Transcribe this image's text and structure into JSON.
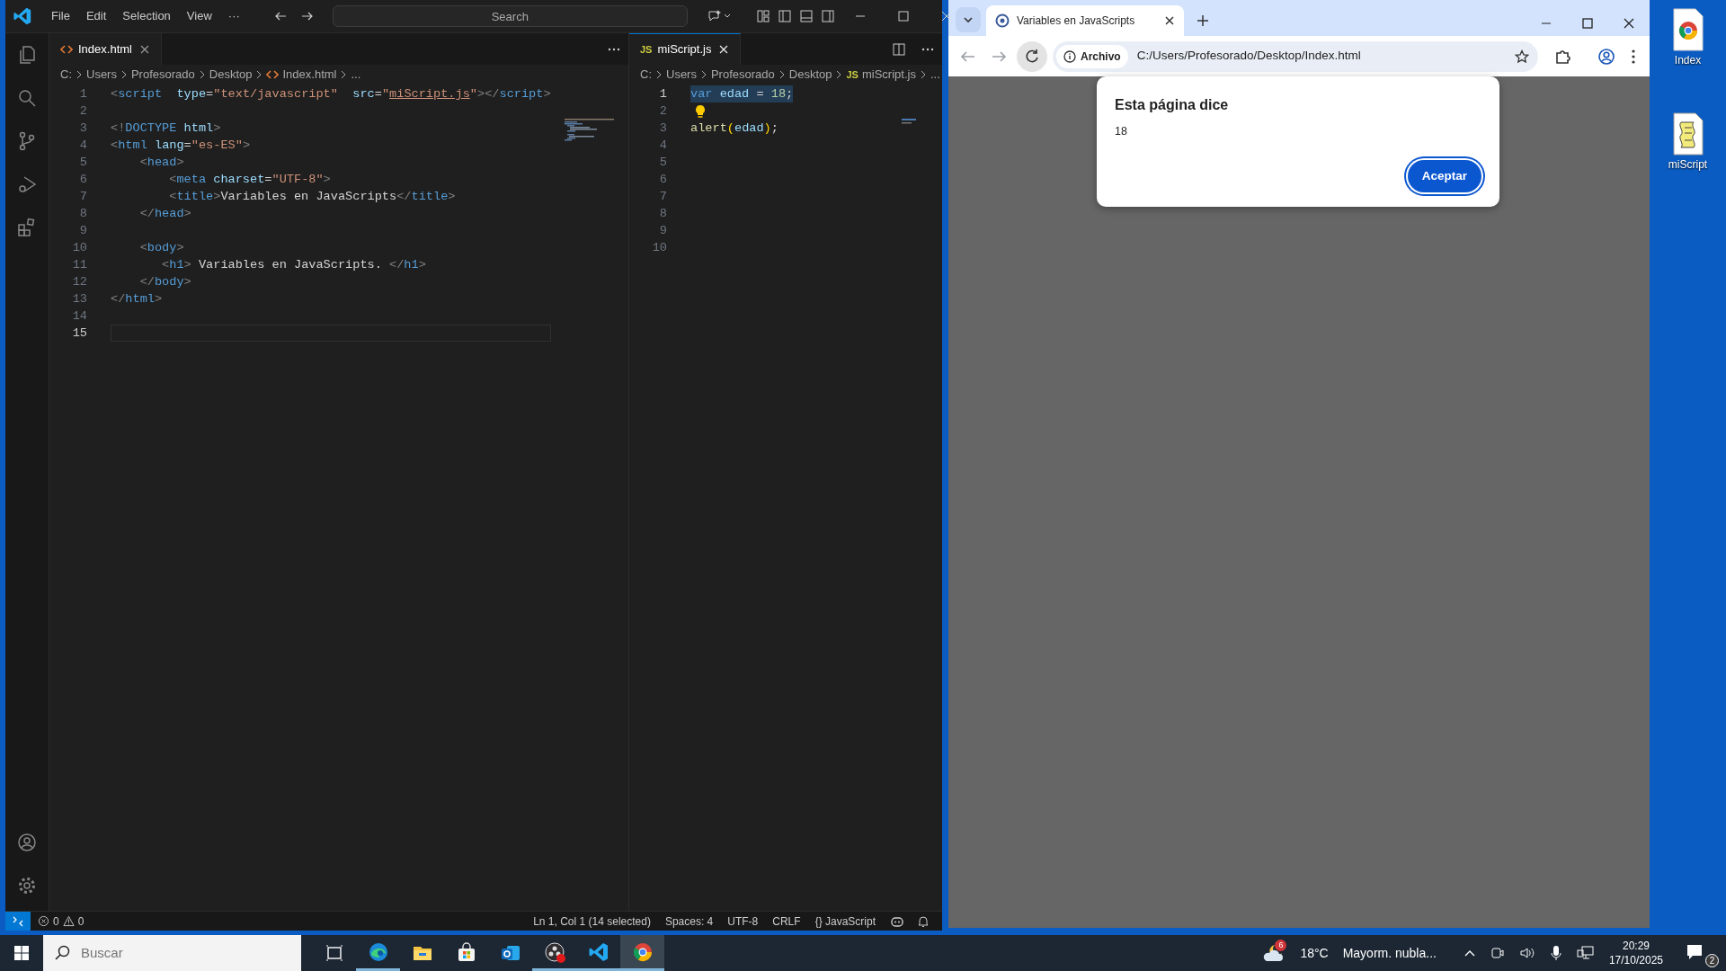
{
  "vscode": {
    "menu": [
      "File",
      "Edit",
      "Selection",
      "View",
      "···"
    ],
    "search": {
      "placeholder": "Search"
    },
    "groups": [
      {
        "focused": false,
        "tab": {
          "label": "Index.html",
          "kind": "html",
          "selected": true
        },
        "breadcrumb": [
          {
            "text": "C:"
          },
          {
            "text": "Users"
          },
          {
            "text": "Profesorado"
          },
          {
            "text": "Desktop"
          },
          {
            "text": "Index.html",
            "kind": "html"
          },
          {
            "text": "..."
          }
        ],
        "lines": [
          {
            "number": "1",
            "current": false,
            "tokens": [
              {
                "kind": "punct",
                "text": "<"
              },
              {
                "kind": "tag",
                "text": "script"
              },
              {
                "kind": "attr",
                "text": "  type"
              },
              {
                "kind": "text",
                "text": "="
              },
              {
                "kind": "string",
                "text": "\"text/javascript\""
              },
              {
                "kind": "attr",
                "text": "  src"
              },
              {
                "kind": "text",
                "text": "="
              },
              {
                "kind": "string",
                "text": "\""
              },
              {
                "kind": "link",
                "text": "miScript.js"
              },
              {
                "kind": "string",
                "text": "\""
              },
              {
                "kind": "punct",
                "text": "></"
              },
              {
                "kind": "tag",
                "text": "script"
              },
              {
                "kind": "punct",
                "text": ">"
              }
            ]
          },
          {
            "number": "2",
            "current": false
          },
          {
            "number": "3",
            "current": false,
            "tokens": [
              {
                "kind": "punct",
                "text": "<!"
              },
              {
                "kind": "tag",
                "text": "DOCTYPE"
              },
              {
                "kind": "attr",
                "text": " html"
              },
              {
                "kind": "punct",
                "text": ">"
              }
            ]
          },
          {
            "number": "4",
            "current": false,
            "tokens": [
              {
                "kind": "punct",
                "text": "<"
              },
              {
                "kind": "tag",
                "text": "html"
              },
              {
                "kind": "attr",
                "text": " lang"
              },
              {
                "kind": "text",
                "text": "="
              },
              {
                "kind": "string",
                "text": "\"es-ES\""
              },
              {
                "kind": "punct",
                "text": ">"
              }
            ]
          },
          {
            "number": "5",
            "current": false,
            "tokens": [
              {
                "kind": "punct",
                "text": "    <"
              },
              {
                "kind": "tag",
                "text": "head"
              },
              {
                "kind": "punct",
                "text": ">"
              }
            ]
          },
          {
            "number": "6",
            "current": false,
            "tokens": [
              {
                "kind": "punct",
                "text": "        <"
              },
              {
                "kind": "tag",
                "text": "meta"
              },
              {
                "kind": "attr",
                "text": " charset"
              },
              {
                "kind": "text",
                "text": "="
              },
              {
                "kind": "string",
                "text": "\"UTF-8\""
              },
              {
                "kind": "punct",
                "text": ">"
              }
            ]
          },
          {
            "number": "7",
            "current": false,
            "tokens": [
              {
                "kind": "punct",
                "text": "        <"
              },
              {
                "kind": "tag",
                "text": "title"
              },
              {
                "kind": "punct",
                "text": ">"
              },
              {
                "kind": "text",
                "text": "Variables en JavaScripts"
              },
              {
                "kind": "punct",
                "text": "</"
              },
              {
                "kind": "tag",
                "text": "title"
              },
              {
                "kind": "punct",
                "text": ">"
              }
            ]
          },
          {
            "number": "8",
            "current": false,
            "tokens": [
              {
                "kind": "punct",
                "text": "    </"
              },
              {
                "kind": "tag",
                "text": "head"
              },
              {
                "kind": "punct",
                "text": ">"
              }
            ]
          },
          {
            "number": "9",
            "current": false
          },
          {
            "number": "10",
            "current": false,
            "tokens": [
              {
                "kind": "punct",
                "text": "    <"
              },
              {
                "kind": "tag",
                "text": "body"
              },
              {
                "kind": "punct",
                "text": ">"
              }
            ]
          },
          {
            "number": "11",
            "current": false,
            "tokens": [
              {
                "kind": "punct",
                "text": "       <"
              },
              {
                "kind": "tag",
                "text": "h1"
              },
              {
                "kind": "punct",
                "text": ">"
              },
              {
                "kind": "text",
                "text": " Variables en JavaScripts. "
              },
              {
                "kind": "punct",
                "text": "</"
              },
              {
                "kind": "tag",
                "text": "h1"
              },
              {
                "kind": "punct",
                "text": ">"
              }
            ]
          },
          {
            "number": "12",
            "current": false,
            "tokens": [
              {
                "kind": "punct",
                "text": "    </"
              },
              {
                "kind": "tag",
                "text": "body"
              },
              {
                "kind": "punct",
                "text": ">"
              }
            ]
          },
          {
            "number": "13",
            "current": false,
            "tokens": [
              {
                "kind": "punct",
                "text": "</"
              },
              {
                "kind": "tag",
                "text": "html"
              },
              {
                "kind": "punct",
                "text": ">"
              }
            ]
          },
          {
            "number": "14",
            "current": false
          },
          {
            "number": "15",
            "current": true
          }
        ]
      },
      {
        "focused": true,
        "tab": {
          "label": "miScript.js",
          "kind": "js",
          "icon_text": "JS",
          "selected": true
        },
        "breadcrumb": [
          {
            "text": "C:"
          },
          {
            "text": "Users"
          },
          {
            "text": "Profesorado"
          },
          {
            "text": "Desktop"
          },
          {
            "text": "miScript.js",
            "kind": "js",
            "icon_text": "JS"
          },
          {
            "text": "..."
          }
        ],
        "lines": [
          {
            "number": "1",
            "current": true,
            "selection": true,
            "tokens": [
              {
                "kind": "keyword",
                "text": "var"
              },
              {
                "kind": "var",
                "text": " edad"
              },
              {
                "kind": "text",
                "text": " = "
              },
              {
                "kind": "number",
                "text": "18"
              },
              {
                "kind": "text",
                "text": ";"
              }
            ]
          },
          {
            "number": "2",
            "current": false,
            "lightbulb": true
          },
          {
            "number": "3",
            "current": false,
            "tokens": [
              {
                "kind": "func",
                "text": "alert"
              },
              {
                "kind": "bracket",
                "text": "("
              },
              {
                "kind": "var",
                "text": "edad"
              },
              {
                "kind": "bracket",
                "text": ")"
              },
              {
                "kind": "text",
                "text": ";"
              }
            ]
          },
          {
            "number": "4",
            "current": false
          },
          {
            "number": "5",
            "current": false
          },
          {
            "number": "6",
            "current": false
          },
          {
            "number": "7",
            "current": false
          },
          {
            "number": "8",
            "current": false
          },
          {
            "number": "9",
            "current": false
          },
          {
            "number": "10",
            "current": false
          }
        ]
      }
    ],
    "status_bar": {
      "errors": "0",
      "warnings": "0",
      "items": [
        "Ln 1, Col 1 (14 selected)",
        "Spaces: 4",
        "UTF-8",
        "CRLF",
        "{} JavaScript"
      ]
    }
  },
  "browser": {
    "tab": {
      "title": "Variables en JavaScripts",
      "selected": true
    },
    "address": {
      "chip": "Archivo",
      "url": "C:/Users/Profesorado/Desktop/Index.html"
    },
    "dialog": {
      "title": "Esta página dice",
      "message": "18",
      "button": "Aceptar"
    }
  },
  "desktop": {
    "icons": [
      {
        "label": "Index",
        "kind": "chrome"
      },
      {
        "label": "miScript",
        "kind": "script"
      }
    ]
  },
  "taskbar": {
    "search": {
      "placeholder": "Buscar"
    },
    "apps": [
      {
        "kind": "taskview",
        "running": false,
        "selected": false
      },
      {
        "kind": "edge",
        "running": true,
        "selected": false
      },
      {
        "kind": "folder",
        "running": false,
        "selected": false
      },
      {
        "kind": "store",
        "running": false,
        "selected": false
      },
      {
        "kind": "outlook",
        "running": false,
        "selected": false
      },
      {
        "kind": "obs",
        "running": true,
        "selected": false
      },
      {
        "kind": "vscode",
        "running": true,
        "selected": false
      },
      {
        "kind": "chrome",
        "running": true,
        "selected": true
      }
    ],
    "weather": {
      "badge": "6",
      "temp": "18°C",
      "summary": "Mayorm. nubla..."
    },
    "time": "20:29",
    "date": "17/10/2025",
    "notifications": "2"
  }
}
